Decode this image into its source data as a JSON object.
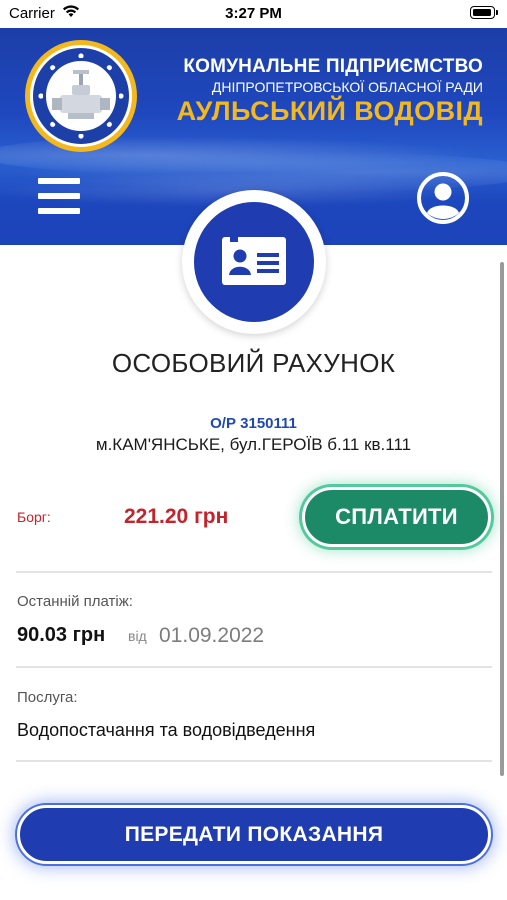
{
  "status_bar": {
    "carrier": "Carrier",
    "time": "3:27 PM"
  },
  "header": {
    "org_line1": "КОМУНАЛЬНЕ ПІДПРИЄМСТВО",
    "org_line2": "ДНІПРОПЕТРОВСЬКОЇ ОБЛАСНОЇ РАДИ",
    "org_line3": "АУЛЬСЬКИЙ ВОДОВІД",
    "menu_icon": "hamburger-menu-icon",
    "profile_icon": "user-circle-icon",
    "badge_icon": "id-card-icon"
  },
  "page": {
    "title": "ОСОБОВИЙ РАХУНОК"
  },
  "account": {
    "number": "О/Р 3150111",
    "address": "м.КАМ'ЯНСЬКЕ, бул.ГЕРОЇВ б.11 кв.111"
  },
  "debt": {
    "label": "Борг:",
    "amount": "221.20 грн",
    "pay_button": "СПЛАТИТИ"
  },
  "last_payment": {
    "label": "Останній платіж:",
    "amount": "90.03 грн",
    "from_word": "від",
    "date": "01.09.2022"
  },
  "service": {
    "label": "Послуга:",
    "value": "Водопостачання та водовідведення"
  },
  "actions": {
    "submit_readings": "ПЕРЕДАТИ ПОКАЗАННЯ"
  },
  "colors": {
    "brand_blue": "#1f3db0",
    "brand_yellow": "#f2b81d",
    "debt_red": "#c3242b",
    "pay_green": "#1c8a66"
  }
}
